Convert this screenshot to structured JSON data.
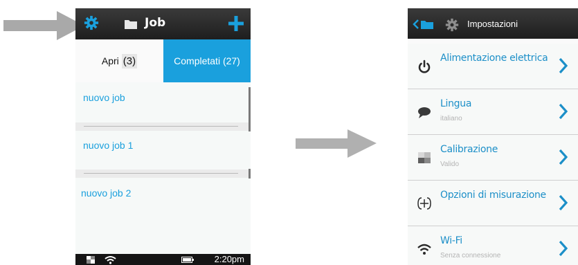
{
  "left_screen": {
    "header": {
      "title": "Job"
    },
    "tabs": {
      "open_label": "Apri",
      "open_count": "(3)",
      "done_label": "Completati (27)"
    },
    "jobs": [
      "nuovo job",
      "nuovo job 1",
      "nuovo job 2"
    ],
    "status_bar": {
      "time": "2:20pm"
    }
  },
  "right_screen": {
    "header": {
      "title": "Impostazioni"
    },
    "settings": [
      {
        "label": "Alimentazione elettrica",
        "sub": "",
        "icon": "power-icon"
      },
      {
        "label": "Lingua",
        "sub": "italiano",
        "icon": "speech-bubble-icon"
      },
      {
        "label": "Calibrazione",
        "sub": "Valido",
        "icon": "calibration-icon"
      },
      {
        "label": "Opzioni di misurazione",
        "sub": "",
        "icon": "measurement-options-icon"
      },
      {
        "label": "Wi-Fi",
        "sub": "Senza connessione",
        "icon": "wifi-icon"
      }
    ]
  },
  "colors": {
    "accent_blue": "#1aa0dd",
    "link_blue": "#1c8fc8",
    "header_dark": "#2a2a2a",
    "pointer_arrow": "#a9a9a9"
  }
}
